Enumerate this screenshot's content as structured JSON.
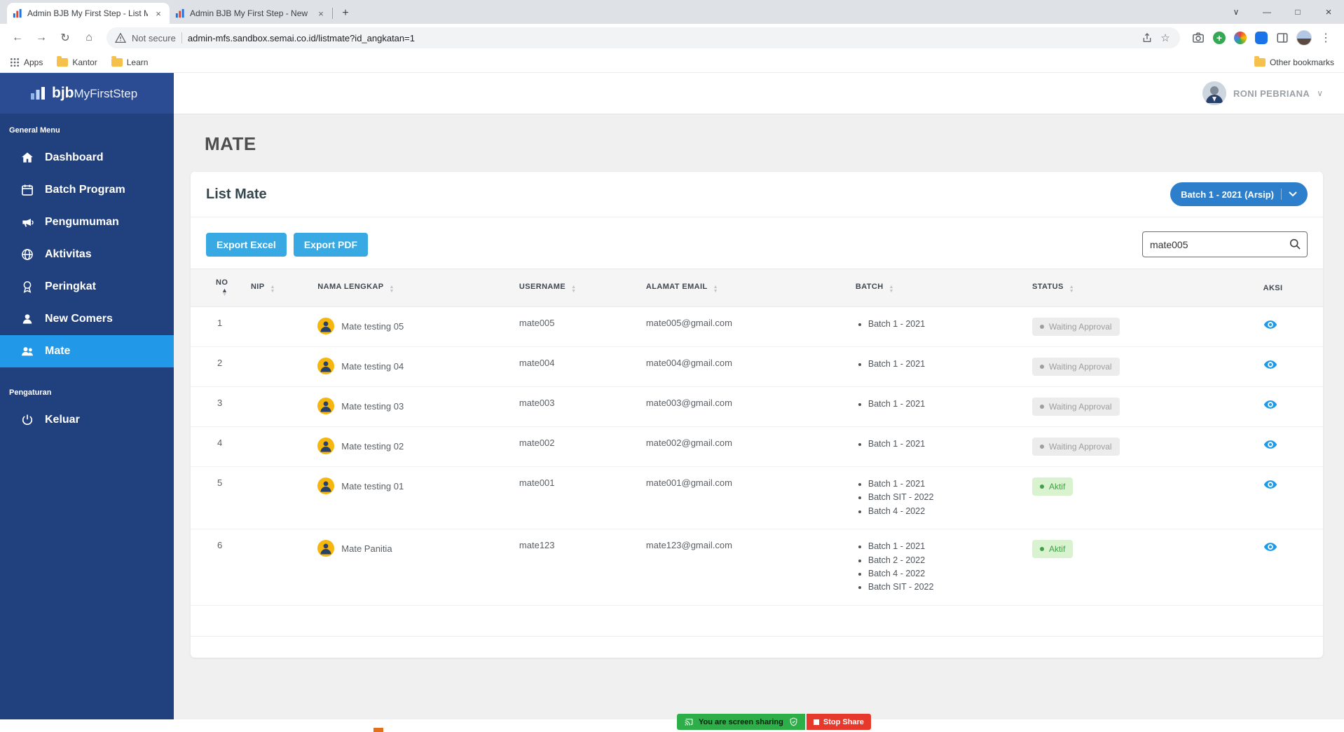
{
  "browser": {
    "tabs": [
      {
        "title": "Admin BJB My First Step - List M..."
      },
      {
        "title": "Admin BJB My First Step - New C..."
      }
    ],
    "security_label": "Not secure",
    "url": "admin-mfs.sandbox.semai.co.id/listmate?id_angkatan=1",
    "bookmarks": [
      "Apps",
      "Kantor",
      "Learn"
    ],
    "other_bookmarks": "Other bookmarks"
  },
  "sidebar": {
    "logo_bold": "bjb",
    "logo_rest": "MyFirstStep",
    "sections": [
      {
        "label": "General Menu",
        "items": [
          {
            "label": "Dashboard"
          },
          {
            "label": "Batch Program"
          },
          {
            "label": "Pengumuman"
          },
          {
            "label": "Aktivitas"
          },
          {
            "label": "Peringkat"
          },
          {
            "label": "New Comers"
          },
          {
            "label": "Mate"
          }
        ]
      },
      {
        "label": "Pengaturan",
        "items": [
          {
            "label": "Keluar"
          }
        ]
      }
    ]
  },
  "header": {
    "user_name": "RONI PEBRIANA"
  },
  "page": {
    "title": "MATE"
  },
  "card": {
    "title": "List Mate",
    "batch_dropdown": "Batch 1 - 2021 (Arsip)",
    "export_excel": "Export Excel",
    "export_pdf": "Export PDF",
    "search_value": "mate005"
  },
  "table": {
    "columns": [
      {
        "label": "NO"
      },
      {
        "label": "NIP"
      },
      {
        "label": "NAMA LENGKAP"
      },
      {
        "label": "USERNAME"
      },
      {
        "label": "ALAMAT EMAIL"
      },
      {
        "label": "BATCH"
      },
      {
        "label": "STATUS"
      },
      {
        "label": "AKSI"
      }
    ],
    "rows": [
      {
        "no": "1",
        "nip": "",
        "name": "Mate testing 05",
        "username": "mate005",
        "email": "mate005@gmail.com",
        "batches": [
          "Batch 1 - 2021"
        ],
        "status": "Waiting Approval",
        "status_type": "waiting"
      },
      {
        "no": "2",
        "nip": "",
        "name": "Mate testing 04",
        "username": "mate004",
        "email": "mate004@gmail.com",
        "batches": [
          "Batch 1 - 2021"
        ],
        "status": "Waiting Approval",
        "status_type": "waiting"
      },
      {
        "no": "3",
        "nip": "",
        "name": "Mate testing 03",
        "username": "mate003",
        "email": "mate003@gmail.com",
        "batches": [
          "Batch 1 - 2021"
        ],
        "status": "Waiting Approval",
        "status_type": "waiting"
      },
      {
        "no": "4",
        "nip": "",
        "name": "Mate testing 02",
        "username": "mate002",
        "email": "mate002@gmail.com",
        "batches": [
          "Batch 1 - 2021"
        ],
        "status": "Waiting Approval",
        "status_type": "waiting"
      },
      {
        "no": "5",
        "nip": "",
        "name": "Mate testing 01",
        "username": "mate001",
        "email": "mate001@gmail.com",
        "batches": [
          "Batch 1 - 2021",
          "Batch SIT - 2022",
          "Batch 4 - 2022"
        ],
        "status": "Aktif",
        "status_type": "aktif"
      },
      {
        "no": "6",
        "nip": "",
        "name": "Mate Panitia",
        "username": "mate123",
        "email": "mate123@gmail.com",
        "batches": [
          "Batch 1 - 2021",
          "Batch 2 - 2022",
          "Batch 4 - 2022",
          "Batch SIT - 2022"
        ],
        "status": "Aktif",
        "status_type": "aktif"
      }
    ]
  },
  "share_bar": {
    "message": "You are screen sharing",
    "stop": "Stop Share"
  },
  "colors": {
    "sidebar_bg": "#21417e",
    "sidebar_active": "#2298e9",
    "primary_blue": "#2d7ecb",
    "export_blue": "#38a9e3",
    "aktif_green": "#43a047",
    "waiting_gray": "#9e9e9e",
    "share_green": "#2eae49",
    "stop_red": "#e6392c"
  }
}
